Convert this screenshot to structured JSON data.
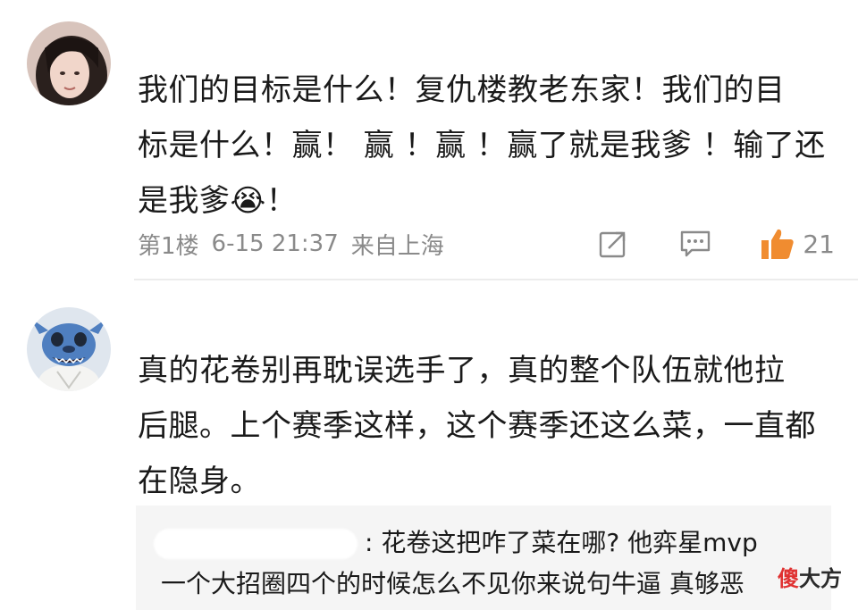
{
  "comments": [
    {
      "avatar": "girl-portrait-avatar",
      "text_lines": [
        "我们的目标是什么！复仇楼教老东家！我们的目",
        "标是什么！赢！ 赢 ！赢 ！赢了就是我爹 ！输了还",
        "是我爹😭！"
      ],
      "floor": "第1楼",
      "datetime": "6-15 21:37",
      "location": "来自上海",
      "like_count": "21"
    },
    {
      "avatar": "stitch-cartoon-avatar",
      "text_lines": [
        "真的花卷别再耽误选手了，真的整个队伍就他拉",
        "后腿。上个赛季这样，这个赛季还这么菜，一直都",
        "在隐身。"
      ],
      "reply": {
        "line1": ": 花卷这把咋了菜在哪? 他弈星mvp",
        "line2": "一个大招圈四个的时候怎么不见你来说句牛逼 真够恶"
      }
    }
  ],
  "watermark": {
    "first": "傻",
    "rest": "大方"
  },
  "colors": {
    "like": "#f08c30",
    "meta": "#8a8a8a",
    "reply_bg": "#f5f5f5"
  },
  "icons": {
    "share": "share-icon",
    "comment": "comment-icon",
    "like": "thumbs-up-icon"
  }
}
